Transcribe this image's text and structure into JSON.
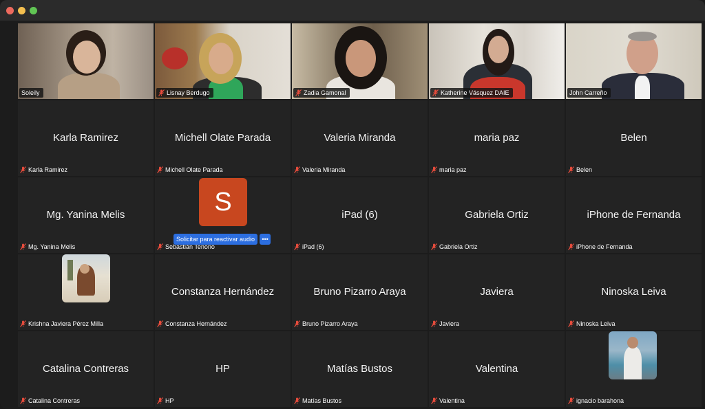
{
  "window": {
    "title": ""
  },
  "colors": {
    "active_speaker": "#3fb950",
    "unmute_button": "#2c6ee0",
    "avatar_bg": "#c8471f"
  },
  "video_tiles": [
    {
      "name": "Soleily",
      "muted": false
    },
    {
      "name": "Lisnay Berdugo",
      "muted": true
    },
    {
      "name": "Zadia Gamonal",
      "muted": true
    },
    {
      "name": "Katherine Vásquez DAIE",
      "muted": true
    },
    {
      "name": "John Carreño",
      "muted": false,
      "active": true
    }
  ],
  "rows": [
    [
      {
        "display": "Karla Ramirez",
        "label": "Karla Ramirez"
      },
      {
        "display": "Michell Olate Parada",
        "label": "Michell Olate Parada"
      },
      {
        "display": "Valeria Miranda",
        "label": "Valeria Miranda"
      },
      {
        "display": "maria paz",
        "label": "maria paz"
      },
      {
        "display": "Belen",
        "label": "Belen"
      }
    ],
    [
      {
        "display": "Mg. Yanina Melis",
        "label": "Mg. Yanina Melis"
      },
      {
        "avatar_letter": "S",
        "label": "Sebastián Tenorio"
      },
      {
        "display": "iPad (6)",
        "label": "iPad (6)"
      },
      {
        "display": "Gabriela Ortiz",
        "label": "Gabriela Ortiz"
      },
      {
        "display": "iPhone de Fernanda",
        "label": "iPhone de Fernanda"
      }
    ],
    [
      {
        "photo": "profile-photo",
        "label": "Krishna Javiera Pérez Milla"
      },
      {
        "display": "Constanza Hernández",
        "label": "Constanza Hernández"
      },
      {
        "display": "Bruno Pizarro Araya",
        "label": "Bruno Pizarro Araya"
      },
      {
        "display": "Javiera",
        "label": "Javiera"
      },
      {
        "display": "Ninoska Leiva",
        "label": "Ninoska Leiva"
      }
    ],
    [
      {
        "display": "Catalina Contreras",
        "label": "Catalina Contreras"
      },
      {
        "display": "HP",
        "label": "HP"
      },
      {
        "display": "Matías Bustos",
        "label": "Matías Bustos"
      },
      {
        "display": "Valentina",
        "label": "Valentina"
      },
      {
        "photo": "profile-photo",
        "label": "ignacio barahona"
      }
    ]
  ],
  "unmute_request": {
    "label": "Solicitar para reactivar audio",
    "more": "•••"
  }
}
